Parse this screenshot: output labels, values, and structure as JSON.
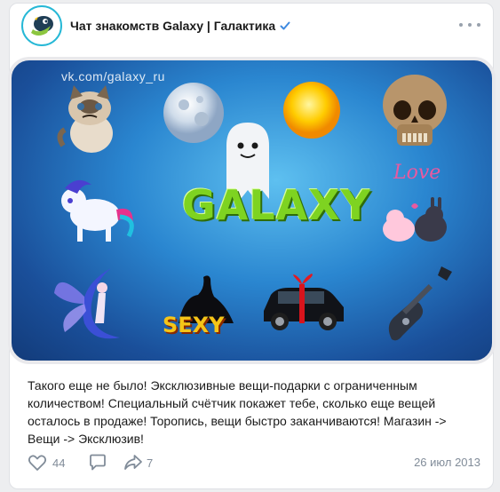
{
  "post": {
    "author": "Чат знакомств Galaxy | Галактика",
    "banner": {
      "watermark": "vk.com/galaxy_ru",
      "logo": "GALAXY",
      "sexy": "SEXY",
      "love": "Love"
    },
    "text_lines": [
      "Такого еще не было! Эксклюзивные вещи-подарки с ограниченным",
      "количеством! Специальный счётчик покажет тебе, сколько еще вещей",
      "осталось в продаже! Торопись, вещи быстро заканчиваются! Магазин ->",
      "Вещи -> Эксклюзив!"
    ],
    "likes": "44",
    "reposts": "7",
    "date": "26 июл 2013"
  },
  "colors": {
    "verified": "#3f8ae0",
    "meta": "#818c99",
    "banner_blue": "#2a86d0"
  },
  "icons": [
    "galaxy-avatar-icon",
    "verified-icon",
    "more-icon",
    "like-icon",
    "comment-icon",
    "share-icon"
  ]
}
